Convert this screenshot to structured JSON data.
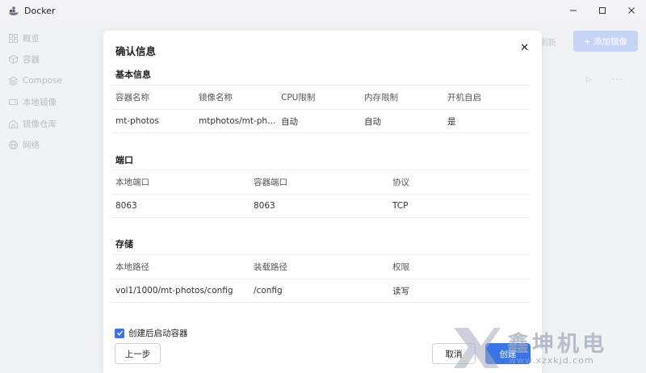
{
  "window": {
    "title": "Docker"
  },
  "sidebar": {
    "items": [
      {
        "label": "概览",
        "icon": "grid-icon"
      },
      {
        "label": "容器",
        "icon": "cube-icon"
      },
      {
        "label": "Compose",
        "icon": "layers-icon"
      },
      {
        "label": "本地镜像",
        "icon": "disk-icon"
      },
      {
        "label": "镜像仓库",
        "icon": "home-icon"
      },
      {
        "label": "网络",
        "icon": "globe-icon"
      }
    ]
  },
  "background": {
    "refresh_label": "刷新",
    "add_image_label": "+ 添加镜像"
  },
  "modal": {
    "title": "确认信息",
    "basic": {
      "title": "基本信息",
      "headers": [
        "容器名称",
        "镜像名称",
        "CPU限制",
        "内存限制",
        "开机自启"
      ],
      "rows": [
        [
          "mt-photos",
          "mtphotos/mt-phot...",
          "自动",
          "自动",
          "是"
        ]
      ]
    },
    "ports": {
      "title": "端口",
      "headers": [
        "本地端口",
        "容器端口",
        "协议"
      ],
      "rows": [
        [
          "8063",
          "8063",
          "TCP"
        ]
      ]
    },
    "storage": {
      "title": "存储",
      "headers": [
        "本地路径",
        "装载路径",
        "权限"
      ],
      "rows": [
        [
          "vol1/1000/mt-photos/config",
          "/config",
          "读写"
        ]
      ]
    },
    "checkbox_label": "创建后启动容器",
    "prev_label": "上一步",
    "cancel_label": "取消",
    "create_label": "创建"
  },
  "watermark": {
    "text": "鑫坤机电",
    "url": "www.xzxkjd.com"
  },
  "colors": {
    "accent": "#3b74e8",
    "accent_light": "#c7d4f5"
  }
}
